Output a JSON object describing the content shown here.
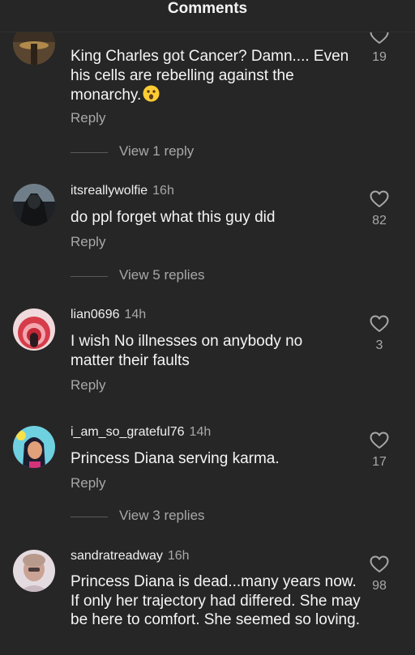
{
  "header": {
    "title": "Comments"
  },
  "comments": [
    {
      "username": "",
      "time": "",
      "text": "King Charles got Cancer?  Damn.... Even his cells are rebelling against the monarchy.",
      "emoji": "astonished-face-emoji",
      "reply_label": "Reply",
      "view_replies_label": "View 1 reply",
      "likes": "19"
    },
    {
      "username": "itsreallywolfie",
      "time": "16h",
      "text": "do ppl forget what this guy did",
      "reply_label": "Reply",
      "view_replies_label": "View 5 replies",
      "likes": "82"
    },
    {
      "username": "lian0696",
      "time": "14h",
      "text": "I wish No illnesses on anybody no matter their faults",
      "reply_label": "Reply",
      "likes": "3"
    },
    {
      "username": "i_am_so_grateful76",
      "time": "14h",
      "text": "Princess Diana serving karma.",
      "reply_label": "Reply",
      "view_replies_label": "View 3 replies",
      "likes": "17"
    },
    {
      "username": "sandratreadway",
      "time": "16h",
      "text": "Princess Diana is dead...many years now.  If only her trajectory had differed. She may be here to comfort.  She seemed so loving.",
      "likes": "98"
    }
  ],
  "icons": {
    "like": "heart-outline-icon"
  },
  "colors": {
    "background": "#262626",
    "text": "#f5f5f5",
    "secondary_text": "#a8a8a8"
  }
}
